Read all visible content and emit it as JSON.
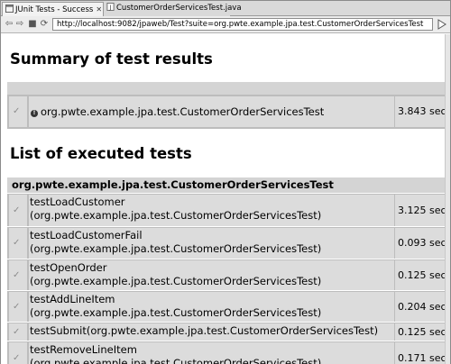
{
  "tabs": [
    {
      "label": "JUnit Tests - Success",
      "active": true
    },
    {
      "label": "CustomerOrderServicesTest.java",
      "active": false
    }
  ],
  "toolbar": {
    "url": "http://localhost:9082/jpaweb/Test?suite=org.pwte.example.jpa.test.CustomerOrderServicesTest"
  },
  "summary": {
    "heading": "Summary of test results",
    "suite": "org.pwte.example.jpa.test.CustomerOrderServicesTest",
    "time": "3.843 sec"
  },
  "list": {
    "heading": "List of executed tests",
    "group": "org.pwte.example.jpa.test.CustomerOrderServicesTest",
    "tests": [
      {
        "name": "testLoadCustomer",
        "class": "(org.pwte.example.jpa.test.CustomerOrderServicesTest)",
        "time": "3.125 sec"
      },
      {
        "name": "testLoadCustomerFail",
        "class": "(org.pwte.example.jpa.test.CustomerOrderServicesTest)",
        "time": "0.093 sec"
      },
      {
        "name": "testOpenOrder",
        "class": "(org.pwte.example.jpa.test.CustomerOrderServicesTest)",
        "time": "0.125 sec"
      },
      {
        "name": "testAddLineItem",
        "class": "(org.pwte.example.jpa.test.CustomerOrderServicesTest)",
        "time": "0.204 sec"
      },
      {
        "name": "testSubmit(org.pwte.example.jpa.test.CustomerOrderServicesTest)",
        "class": "",
        "time": "0.125 sec"
      },
      {
        "name": "testRemoveLineItem",
        "class": "(org.pwte.example.jpa.test.CustomerOrderServicesTest)",
        "time": "0.171 sec"
      }
    ]
  },
  "icons": {
    "pass": "check-icon",
    "info": "info-icon"
  }
}
